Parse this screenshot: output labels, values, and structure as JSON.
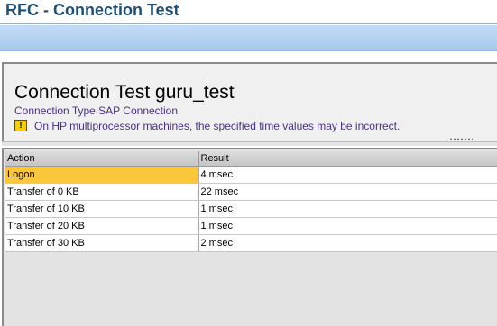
{
  "app": {
    "title": "RFC - Connection Test"
  },
  "header": {
    "title": "Connection Test guru_test",
    "connection_type": "Connection Type SAP Connection",
    "warning_text": "On HP multiprocessor machines, the specified time values may be incorrect.",
    "warning_icon": "warning-icon"
  },
  "table": {
    "columns": [
      "Action",
      "Result"
    ],
    "rows": [
      {
        "action": "Logon",
        "result": "4 msec"
      },
      {
        "action": "Transfer of 0 KB",
        "result": "22 msec"
      },
      {
        "action": "Transfer of 10 KB",
        "result": "1 msec"
      },
      {
        "action": "Transfer of 20 KB",
        "result": "1 msec"
      },
      {
        "action": "Transfer of 30 KB",
        "result": "2 msec"
      }
    ]
  },
  "colors": {
    "title": "#1e4f78",
    "toolbar": "#b5d1f0",
    "selected_cell": "#f9c739",
    "info_text": "#4b2f87"
  }
}
